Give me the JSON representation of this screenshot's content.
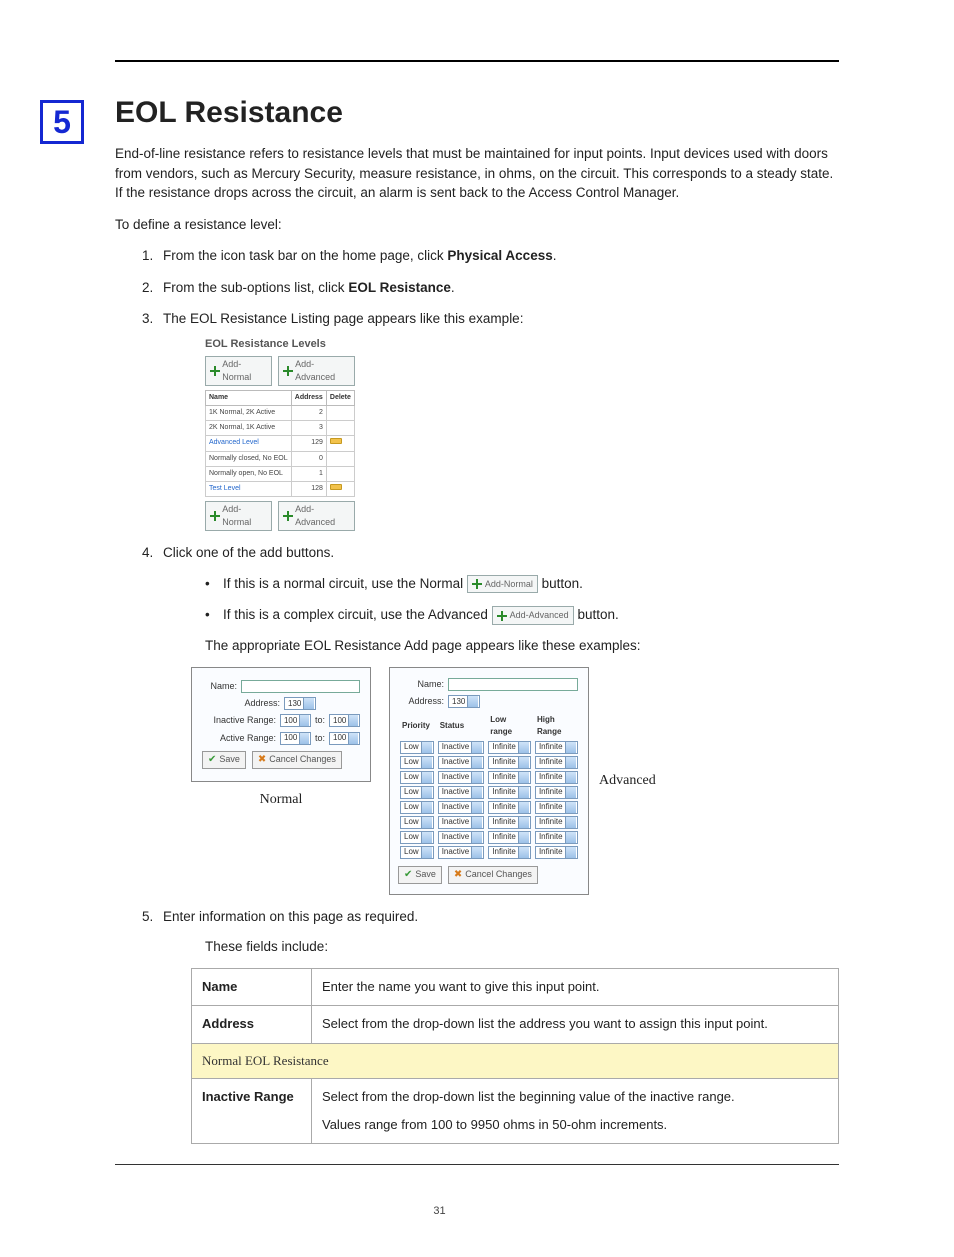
{
  "chapter_number": "5",
  "title": "EOL Resistance",
  "intro": "End-of-line resistance refers to resistance levels that must be maintained for input points. Input devices used with doors from vendors, such as Mercury Security, measure resistance, in ohms, on the circuit. This corresponds to a steady state. If the resistance drops across the circuit, an alarm is sent back to the Access Control Manager.",
  "lead_in": "To define a resistance level:",
  "steps": {
    "s1a": "From the icon task bar on the home page, click ",
    "s1b": "Physical Access",
    "s1c": ".",
    "s2a": "From the sub-options list, click ",
    "s2b": "EOL Resistance",
    "s2c": ".",
    "s3": "The EOL Resistance Listing page appears like this example:",
    "s4": "Click one of the add buttons.",
    "b1a": "If this is a normal circuit, use the Normal ",
    "b1b": " button.",
    "b2a": "If this is a complex circuit, use the Advanced ",
    "b2b": " button.",
    "after4": "The appropriate EOL Resistance Add page appears like these examples:",
    "s5": "Enter information on this page as required.",
    "s5b": "These fields include:"
  },
  "chip_normal": "Add-Normal",
  "chip_advanced": "Add-Advanced",
  "shot1": {
    "title": "EOL Resistance Levels",
    "cols": {
      "name": "Name",
      "address": "Address",
      "delete": "Delete"
    },
    "rows": [
      {
        "name": "1K Normal, 2K Active",
        "addr": "2",
        "del": false,
        "link": false
      },
      {
        "name": "2K Normal, 1K Active",
        "addr": "3",
        "del": false,
        "link": false
      },
      {
        "name": "Advanced Level",
        "addr": "129",
        "del": true,
        "link": true
      },
      {
        "name": "Normally closed, No EOL",
        "addr": "0",
        "del": false,
        "link": false
      },
      {
        "name": "Normally open, No EOL",
        "addr": "1",
        "del": false,
        "link": false
      },
      {
        "name": "Test Level",
        "addr": "128",
        "del": true,
        "link": true
      }
    ]
  },
  "normal_form": {
    "name_label": "Name:",
    "addr_label": "Address:",
    "addr_val": "130",
    "ir_label": "Inactive Range:",
    "ar_label": "Active Range:",
    "v": "100",
    "to": "to:",
    "save": "Save",
    "cancel": "Cancel Changes",
    "caption": "Normal"
  },
  "adv_form": {
    "name_label": "Name:",
    "addr_label": "Address:",
    "addr_val": "130",
    "cols": {
      "priority": "Priority",
      "status": "Status",
      "low": "Low range",
      "high": "High Range"
    },
    "cell": {
      "p": "Low",
      "s": "Inactive",
      "l": "Infinite",
      "h": "Infinite"
    },
    "save": "Save",
    "cancel": "Cancel Changes",
    "caption": "Advanced",
    "row_count": 8
  },
  "fields_table": {
    "name_h": "Name",
    "name_d": "Enter the name you want to give this input point.",
    "addr_h": "Address",
    "addr_d": "Select from the drop-down list the address you want to assign this input point.",
    "section": "Normal EOL Resistance",
    "ir_h": "Inactive Range",
    "ir_d1": "Select from the drop-down list the beginning value of the inactive range.",
    "ir_d2": "Values range from 100 to 9950 ohms in 50-ohm increments."
  },
  "page_number": "31"
}
